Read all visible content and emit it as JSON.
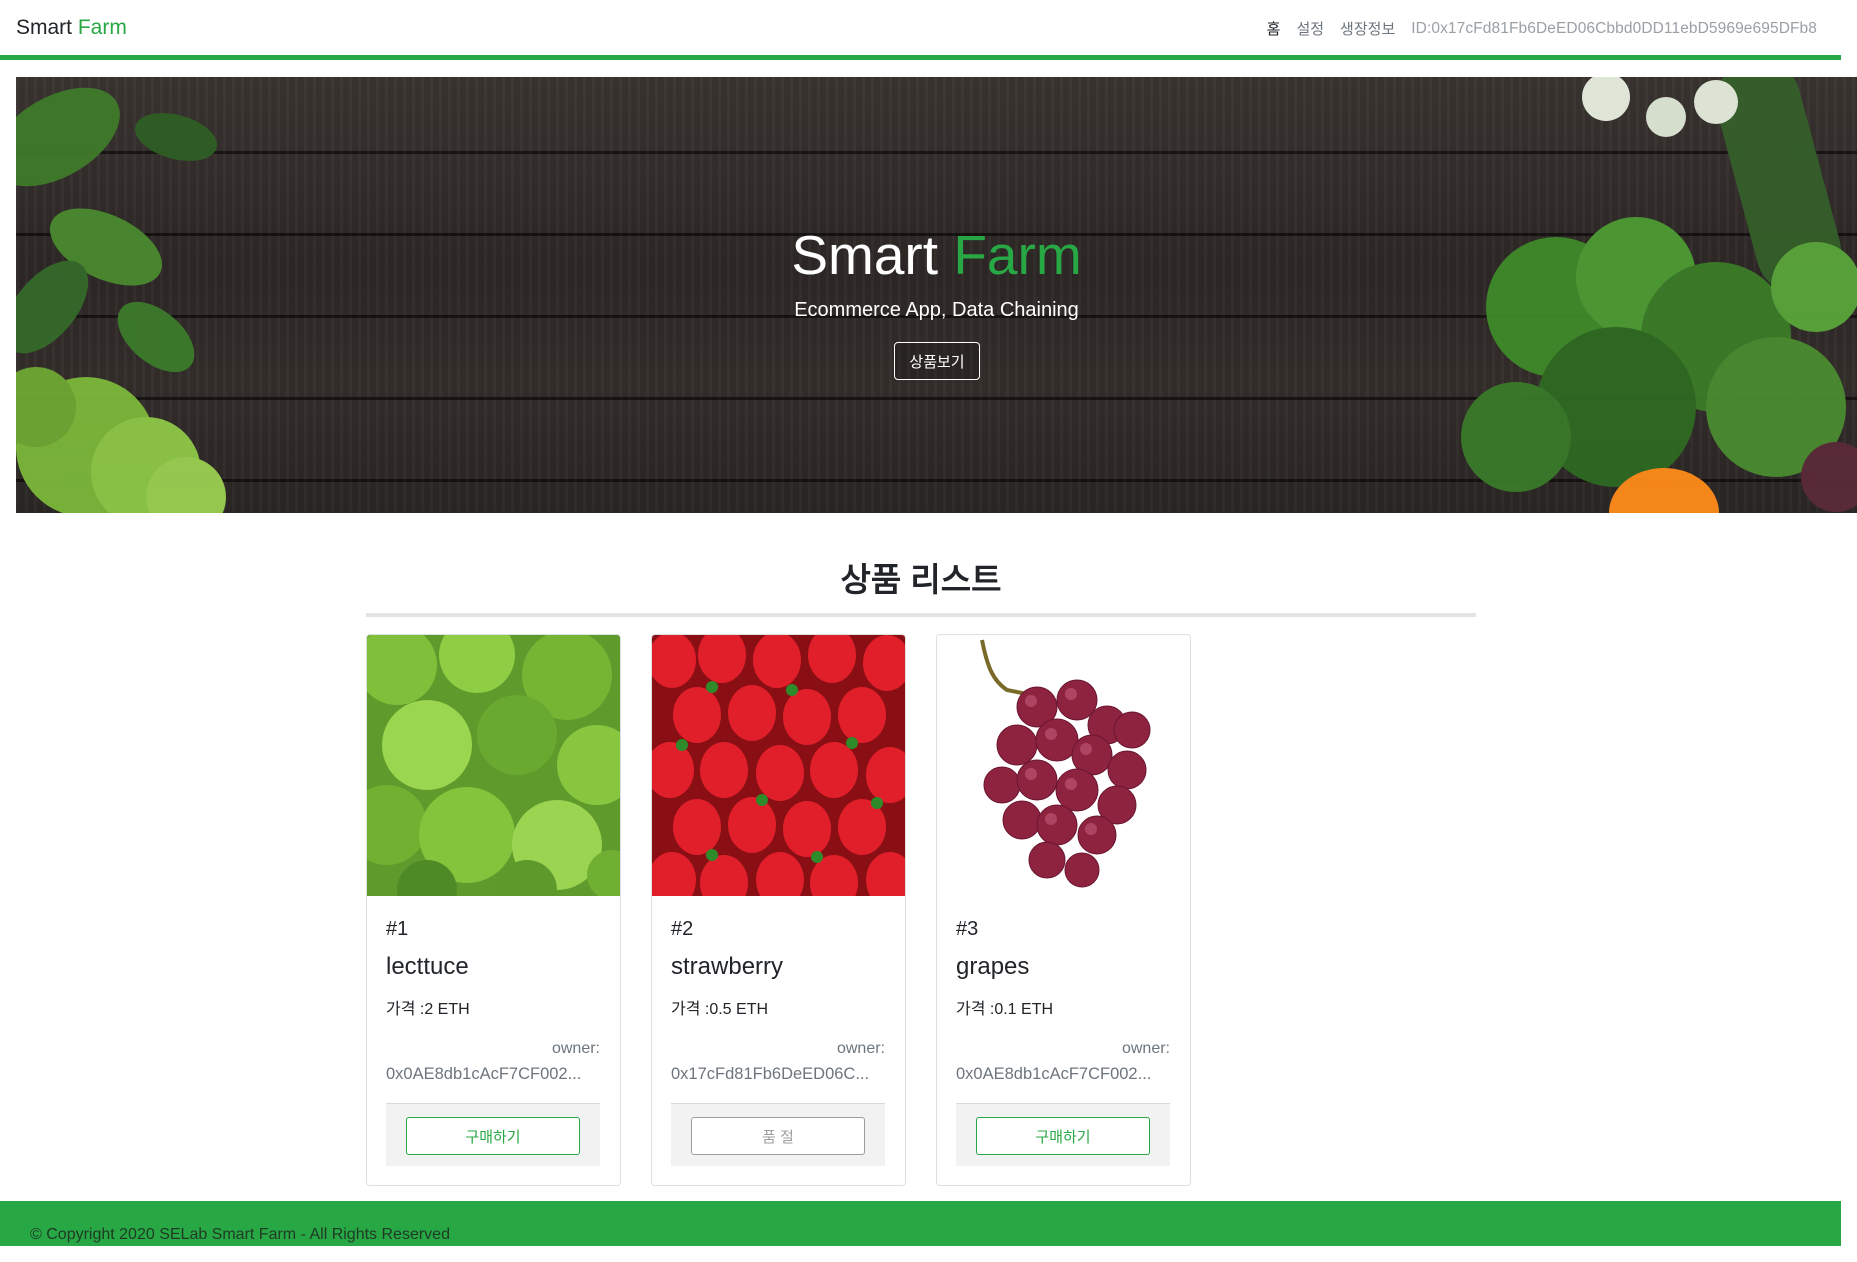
{
  "navbar": {
    "brand_main": "Smart",
    "brand_accent": "Farm",
    "links": [
      {
        "label": "홈"
      },
      {
        "label": "설정"
      },
      {
        "label": "생장정보"
      }
    ],
    "user_id": "ID:0x17cFd81Fb6DeED06Cbbd0DD11ebD5969e695DFb8"
  },
  "hero": {
    "title_main": "Smart",
    "title_accent": "Farm",
    "subtitle": "Ecommerce App, Data Chaining",
    "button_label": "상품보기"
  },
  "products_section": {
    "title": "상품 리스트",
    "cards": [
      {
        "number": "#1",
        "name": "lecttuce",
        "price": "가격 :2 ETH",
        "owner_label": "owner:",
        "owner": "0x0AE8db1cAcF7CF002...",
        "button_label": "구매하기",
        "image_icon": "lettuce-image"
      },
      {
        "number": "#2",
        "name": "strawberry",
        "price": "가격 :0.5 ETH",
        "owner_label": "owner:",
        "owner": "0x17cFd81Fb6DeED06C...",
        "button_label": "품 절",
        "image_icon": "strawberry-image"
      },
      {
        "number": "#3",
        "name": "grapes",
        "price": "가격 :0.1 ETH",
        "owner_label": "owner:",
        "owner": "0x0AE8db1cAcF7CF002...",
        "button_label": "구매하기",
        "image_icon": "grapes-image"
      }
    ]
  },
  "footer": {
    "copyright": "© Copyright 2020 SELab Smart Farm - All Rights Reserved"
  },
  "colors": {
    "accent": "#28a745",
    "muted": "#6c757d",
    "sold_out": "#9e9e9e"
  }
}
